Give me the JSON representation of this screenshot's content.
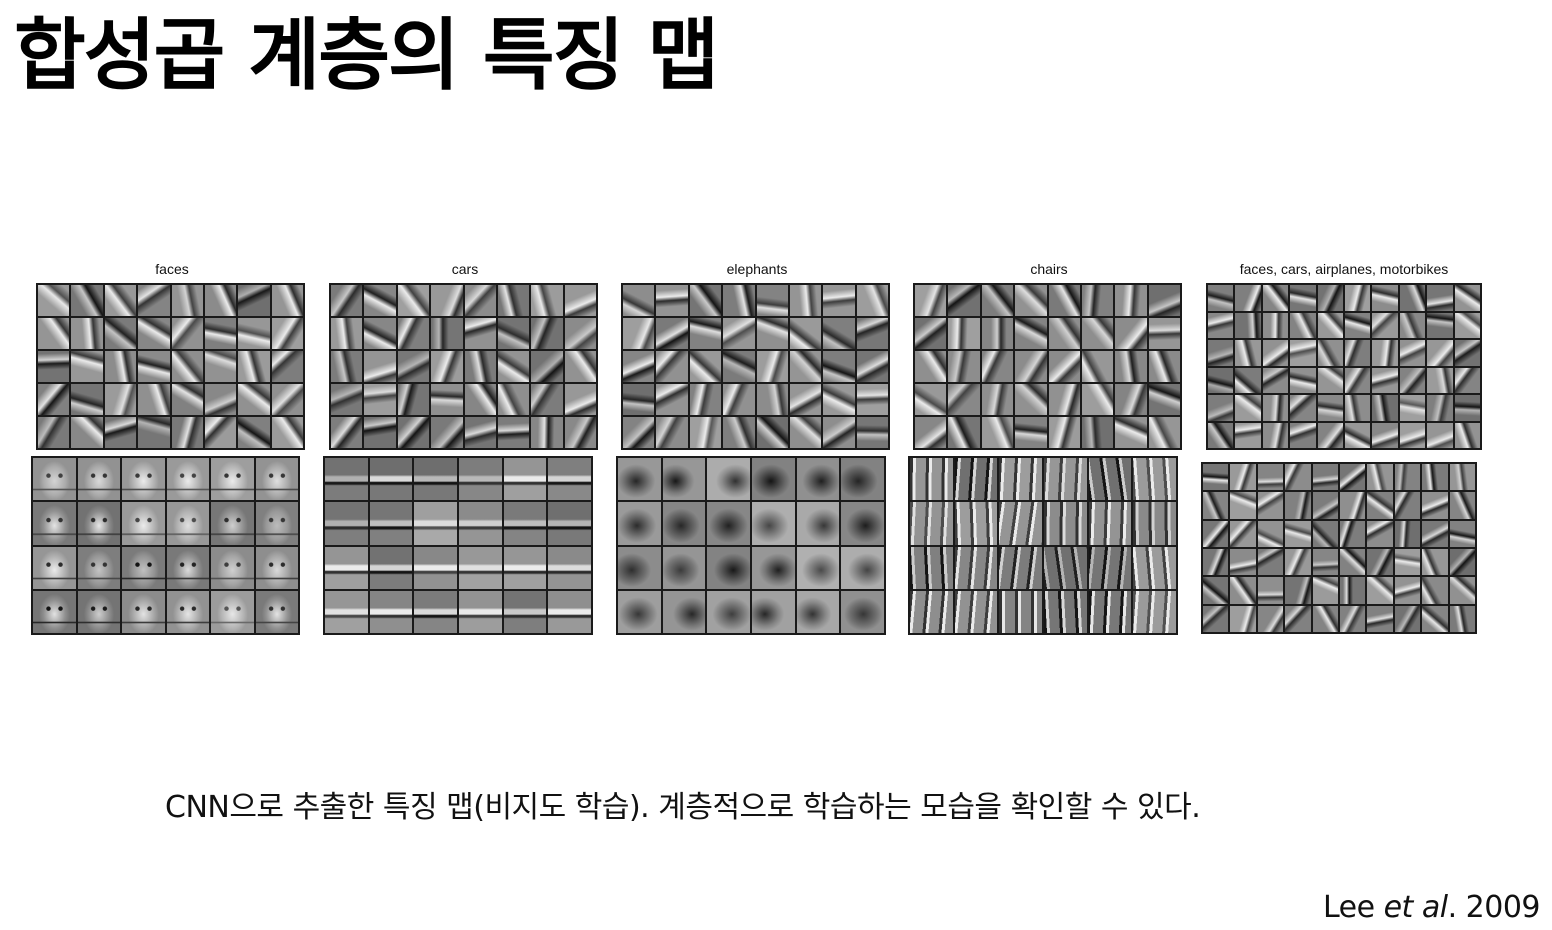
{
  "title": "합성곱 계층의 특징 맵",
  "panels": [
    {
      "label": "faces"
    },
    {
      "label": "cars"
    },
    {
      "label": "elephants"
    },
    {
      "label": "chairs"
    },
    {
      "label": "faces, cars, airplanes, motorbikes"
    }
  ],
  "caption": "CNN으로 추출한 특징 맵(비지도 학습). 계층적으로 학습하는 모습을 확인할 수 있다.",
  "citation": {
    "author": "Lee ",
    "etal": "et al",
    "year": ". 2009"
  }
}
